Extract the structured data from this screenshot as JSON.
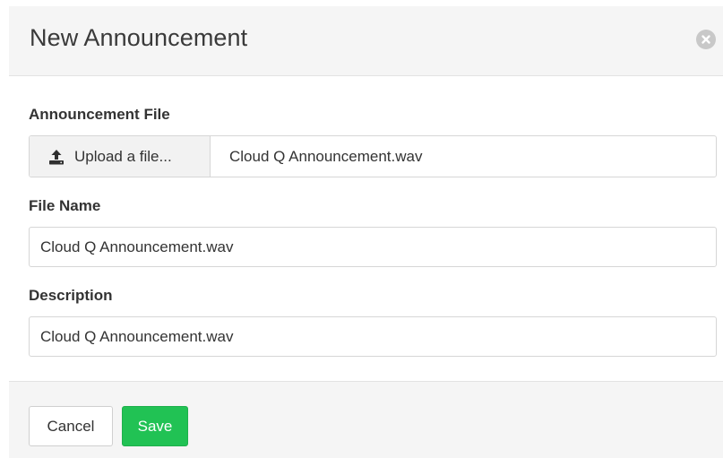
{
  "modal": {
    "title": "New Announcement",
    "close_icon": "close-circle-icon"
  },
  "form": {
    "announcement_file": {
      "label": "Announcement File",
      "upload_button_label": "Upload a file...",
      "upload_icon": "upload-icon",
      "selected_file": "Cloud Q Announcement.wav"
    },
    "file_name": {
      "label": "File Name",
      "value": "Cloud Q Announcement.wav"
    },
    "description": {
      "label": "Description",
      "value": "Cloud Q Announcement.wav"
    }
  },
  "footer": {
    "cancel_label": "Cancel",
    "save_label": "Save"
  },
  "colors": {
    "header_bg": "#f5f5f5",
    "save_button": "#21c254",
    "close_icon": "#c8c8c8"
  }
}
